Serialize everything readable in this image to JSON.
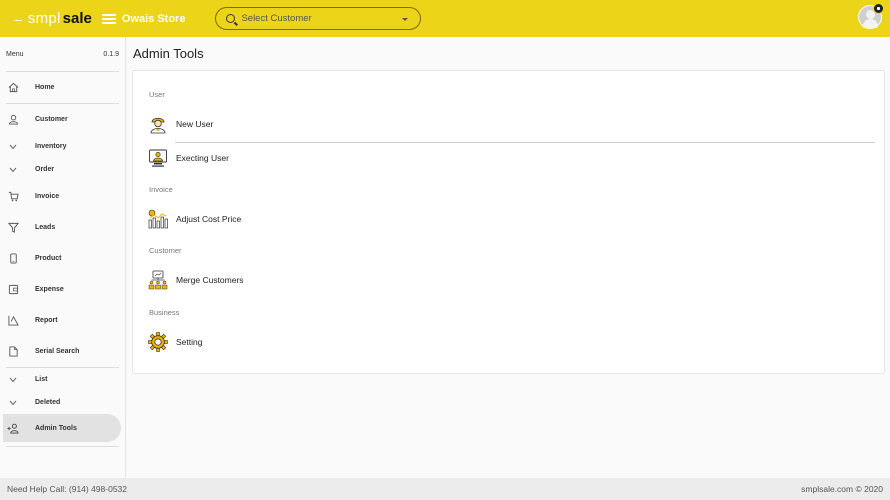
{
  "header": {
    "logo_dash": "–",
    "logo_smpl": "smpl",
    "logo_sale": "sale",
    "store_name": "Owais Store",
    "search_placeholder": "Select Customer"
  },
  "sidebar": {
    "menu_label": "Menu",
    "version": "0.1.9",
    "items": [
      {
        "label": "Home"
      },
      {
        "label": "Customer"
      },
      {
        "label": "Inventory"
      },
      {
        "label": "Order"
      },
      {
        "label": "Invoice"
      },
      {
        "label": "Leads"
      },
      {
        "label": "Product"
      },
      {
        "label": "Expense"
      },
      {
        "label": "Report"
      },
      {
        "label": "Serial Search"
      },
      {
        "label": "List"
      },
      {
        "label": "Deleted"
      },
      {
        "label": "Admin Tools"
      }
    ]
  },
  "main": {
    "title": "Admin Tools",
    "sections": [
      {
        "label": "User",
        "tools": [
          {
            "label": "New User"
          },
          {
            "label": "Execting User"
          }
        ]
      },
      {
        "label": "Invoice",
        "tools": [
          {
            "label": "Adjust Cost Price"
          }
        ]
      },
      {
        "label": "Customer",
        "tools": [
          {
            "label": "Merge Customers"
          }
        ]
      },
      {
        "label": "Business",
        "tools": [
          {
            "label": "Setting"
          }
        ]
      }
    ]
  },
  "footer": {
    "help": "Need Help Call: (914) 498-0532",
    "copyright": "smplsale.com © 2020"
  },
  "colors": {
    "accent": "#ecd418"
  }
}
